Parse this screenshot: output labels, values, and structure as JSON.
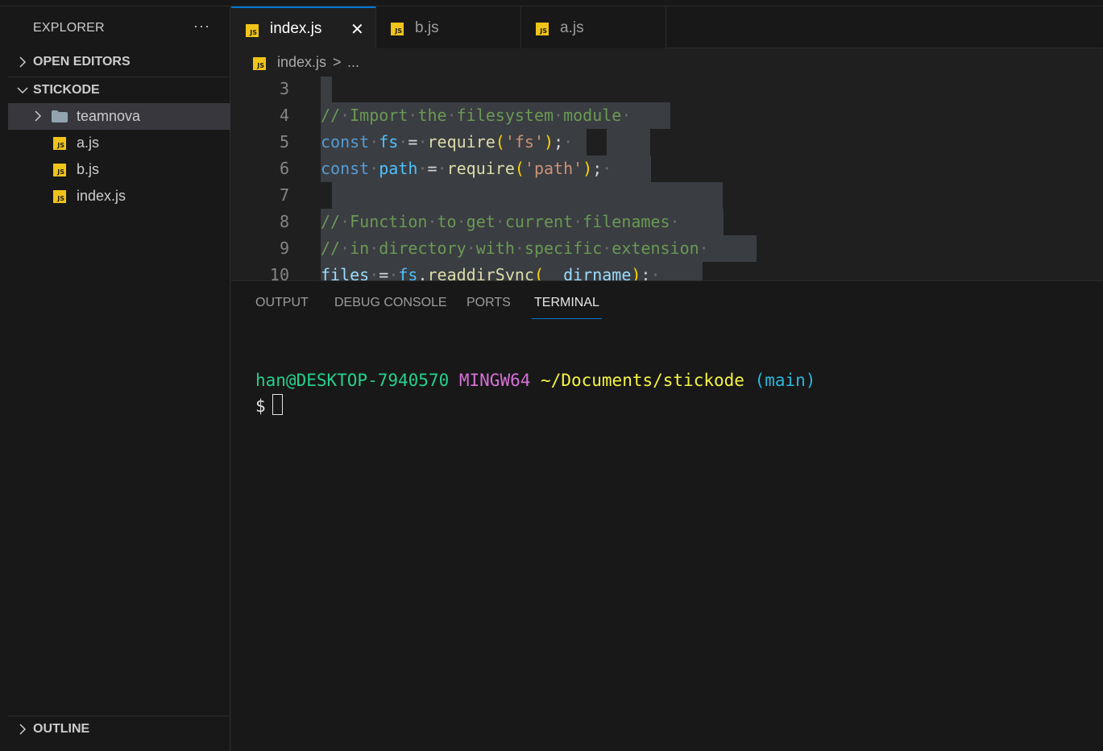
{
  "sidebar": {
    "title": "EXPLORER",
    "more": "···",
    "sections": {
      "open_editors": "OPEN EDITORS",
      "project": "STICKODE",
      "outline": "OUTLINE"
    },
    "tree": [
      {
        "label": "teamnova",
        "type": "folder"
      },
      {
        "label": "a.js",
        "type": "js"
      },
      {
        "label": "b.js",
        "type": "js"
      },
      {
        "label": "index.js",
        "type": "js"
      }
    ]
  },
  "tabs": [
    {
      "label": "index.js",
      "active": true,
      "close": "✕"
    },
    {
      "label": "b.js",
      "active": false
    },
    {
      "label": "a.js",
      "active": false
    }
  ],
  "js_badge": "JS",
  "breadcrumb": {
    "file": "index.js",
    "sep": ">",
    "more": "..."
  },
  "editor": {
    "line_numbers": [
      "3",
      "4",
      "5",
      "6",
      "7",
      "8",
      "9",
      "10"
    ]
  },
  "panel": {
    "tabs": [
      "OUTPUT",
      "DEBUG CONSOLE",
      "PORTS",
      "TERMINAL"
    ],
    "active_tab": "TERMINAL",
    "terminal": {
      "user_host": "han@DESKTOP-7940570",
      "env": "MINGW64",
      "path": "~/Documents/stickode",
      "branch": "(main)",
      "prompt": "$"
    }
  },
  "colors": {
    "accent": "#0078d4",
    "js_icon": "#f0c419",
    "comment": "#6a9955",
    "keyword": "#569cd6"
  }
}
